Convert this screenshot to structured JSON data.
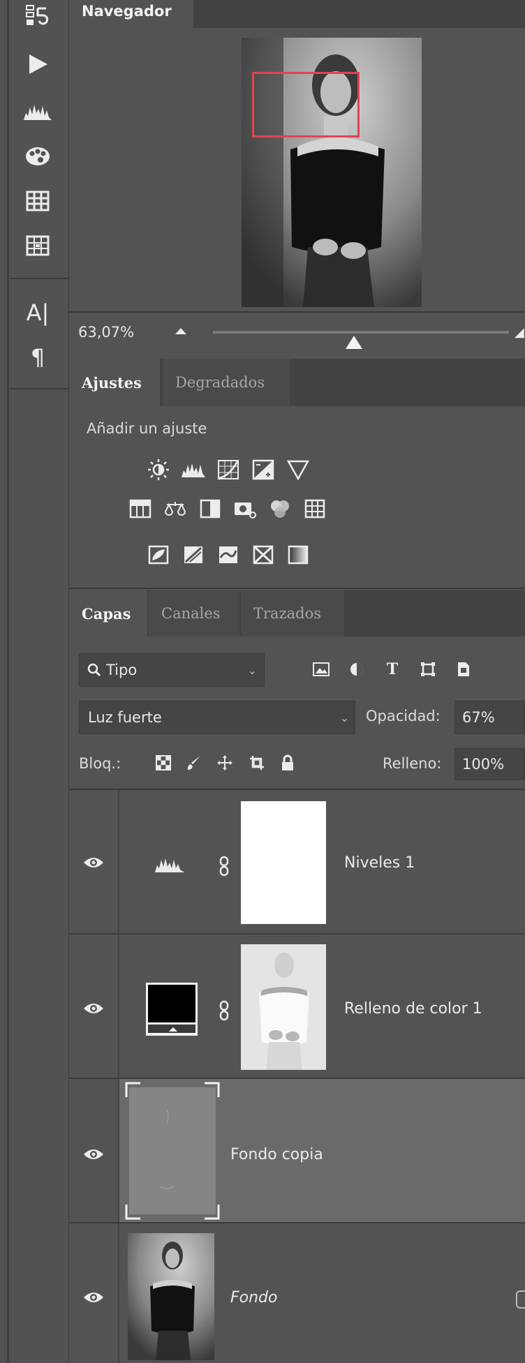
{
  "toolbar": {
    "icons": [
      "history-icon",
      "play-action-icon",
      "histogram-icon",
      "palette-icon",
      "table-grid-icon",
      "glyph-grid-icon",
      "character-text-icon",
      "paragraph-icon"
    ],
    "character_symbol": "A|",
    "paragraph_symbol": "¶"
  },
  "navigator": {
    "tab_label": "Navegador",
    "zoom_value": "63,07%"
  },
  "adjustments": {
    "tabs": [
      "Ajustes",
      "Degradados"
    ],
    "add_label": "Añadir un ajuste"
  },
  "layers_panel": {
    "tabs": [
      "Capas",
      "Canales",
      "Trazados"
    ],
    "filter_label": "Tipo",
    "blend_mode": "Luz fuerte",
    "opacity_label": "Opacidad:",
    "opacity_value": "67%",
    "lock_label": "Bloq.:",
    "fill_label": "Relleno:",
    "fill_value": "100%",
    "layers": [
      {
        "name": "Niveles 1",
        "kind": "adjustment-levels"
      },
      {
        "name": "Relleno de color 1",
        "kind": "solid-color-fill"
      },
      {
        "name": "Fondo copia",
        "kind": "pixel",
        "selected": true
      },
      {
        "name": "Fondo",
        "kind": "background"
      }
    ]
  },
  "colors": {
    "panel_bg": "#535353",
    "tab_bar_bg": "#424242",
    "selected_layer_bg": "#6a6a6a",
    "navigator_frame": "#e0454d"
  }
}
